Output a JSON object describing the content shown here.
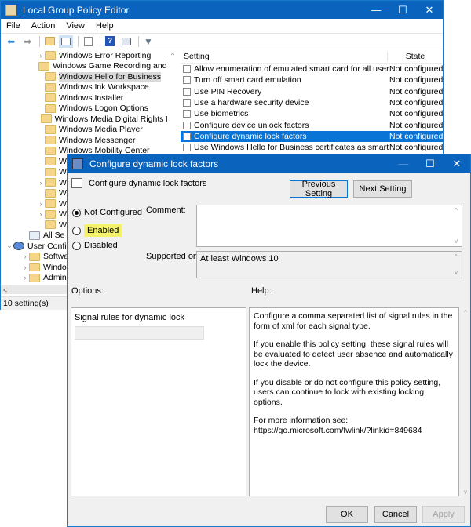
{
  "main_window": {
    "title": "Local Group Policy Editor",
    "controls": {
      "minimize": "—",
      "maximize": "☐",
      "close": "✕"
    },
    "menu": [
      "File",
      "Action",
      "View",
      "Help"
    ],
    "toolbar_icons": [
      "back-arrow-icon",
      "forward-arrow-icon",
      "up-folder-icon",
      "show-hide-tree-icon",
      "export-list-icon",
      "help-icon",
      "properties-icon",
      "filter-icon"
    ],
    "tree": [
      {
        "label": "Windows Error Reporting",
        "expandable": true,
        "indent": 1
      },
      {
        "label": "Windows Game Recording and Br",
        "expandable": false,
        "indent": 1
      },
      {
        "label": "Windows Hello for Business",
        "expandable": false,
        "indent": 1,
        "selected": true
      },
      {
        "label": "Windows Ink Workspace",
        "expandable": false,
        "indent": 1
      },
      {
        "label": "Windows Installer",
        "expandable": false,
        "indent": 1
      },
      {
        "label": "Windows Logon Options",
        "expandable": false,
        "indent": 1
      },
      {
        "label": "Windows Media Digital Rights Ma",
        "expandable": false,
        "indent": 1
      },
      {
        "label": "Windows Media Player",
        "expandable": false,
        "indent": 1
      },
      {
        "label": "Windows Messenger",
        "expandable": false,
        "indent": 1
      },
      {
        "label": "Windows Mobility Center",
        "expandable": false,
        "indent": 1
      },
      {
        "label": "W",
        "expandable": false,
        "indent": 1
      },
      {
        "label": "W",
        "expandable": false,
        "indent": 1
      },
      {
        "label": "W",
        "expandable": true,
        "indent": 1
      },
      {
        "label": "W",
        "expandable": false,
        "indent": 1
      },
      {
        "label": "W",
        "expandable": true,
        "indent": 1
      },
      {
        "label": "W",
        "expandable": true,
        "indent": 1
      },
      {
        "label": "W",
        "expandable": false,
        "indent": 1
      },
      {
        "label": "All Se",
        "expandable": false,
        "indent": 0.5,
        "icon": "all-settings"
      },
      {
        "label": "User Configu",
        "expandable": "open",
        "indent": 0,
        "icon": "user-config"
      },
      {
        "label": "Software",
        "expandable": true,
        "indent": 0.5
      },
      {
        "label": "Windows",
        "expandable": true,
        "indent": 0.5
      },
      {
        "label": "Administ",
        "expandable": true,
        "indent": 0.5
      }
    ],
    "list": {
      "headers": {
        "setting": "Setting",
        "state": "State"
      },
      "rows": [
        {
          "setting": "Allow enumeration of emulated smart card for all users",
          "state": "Not configured"
        },
        {
          "setting": "Turn off smart card emulation",
          "state": "Not configured"
        },
        {
          "setting": "Use PIN Recovery",
          "state": "Not configured"
        },
        {
          "setting": "Use a hardware security device",
          "state": "Not configured"
        },
        {
          "setting": "Use biometrics",
          "state": "Not configured"
        },
        {
          "setting": "Configure device unlock factors",
          "state": "Not configured"
        },
        {
          "setting": "Configure dynamic lock factors",
          "state": "Not configured",
          "selected": true
        },
        {
          "setting": "Use Windows Hello for Business certificates as smart card ce...",
          "state": "Not configured"
        }
      ]
    },
    "status": "10 setting(s)"
  },
  "dialog": {
    "title": "Configure dynamic lock factors",
    "subtitle": "Configure dynamic lock factors",
    "controls": {
      "maximize": "☐",
      "close": "✕"
    },
    "previous_button": "Previous Setting",
    "next_button": "Next Setting",
    "radios": [
      {
        "label": "Not Configured",
        "checked": true
      },
      {
        "label": "Enabled",
        "checked": false,
        "highlighted": true
      },
      {
        "label": "Disabled",
        "checked": false
      }
    ],
    "comment_label": "Comment:",
    "comment_value": "",
    "supported_label": "Supported on:",
    "supported_value": "At least Windows 10",
    "options_label": "Options:",
    "help_label": "Help:",
    "option_field_label": "Signal rules for dynamic lock",
    "option_field_value": "",
    "help_paragraphs": [
      "Configure a comma separated list of signal rules in the form of xml for each signal type.",
      "If you enable this policy setting, these signal rules will be evaluated to detect user absence and automatically lock the device.",
      "If you disable or do not configure this policy setting, users can continue to lock with existing locking options.",
      "For more information see: https://go.microsoft.com/fwlink/?linkid=849684"
    ],
    "ok_button": "OK",
    "cancel_button": "Cancel",
    "apply_button": "Apply"
  }
}
